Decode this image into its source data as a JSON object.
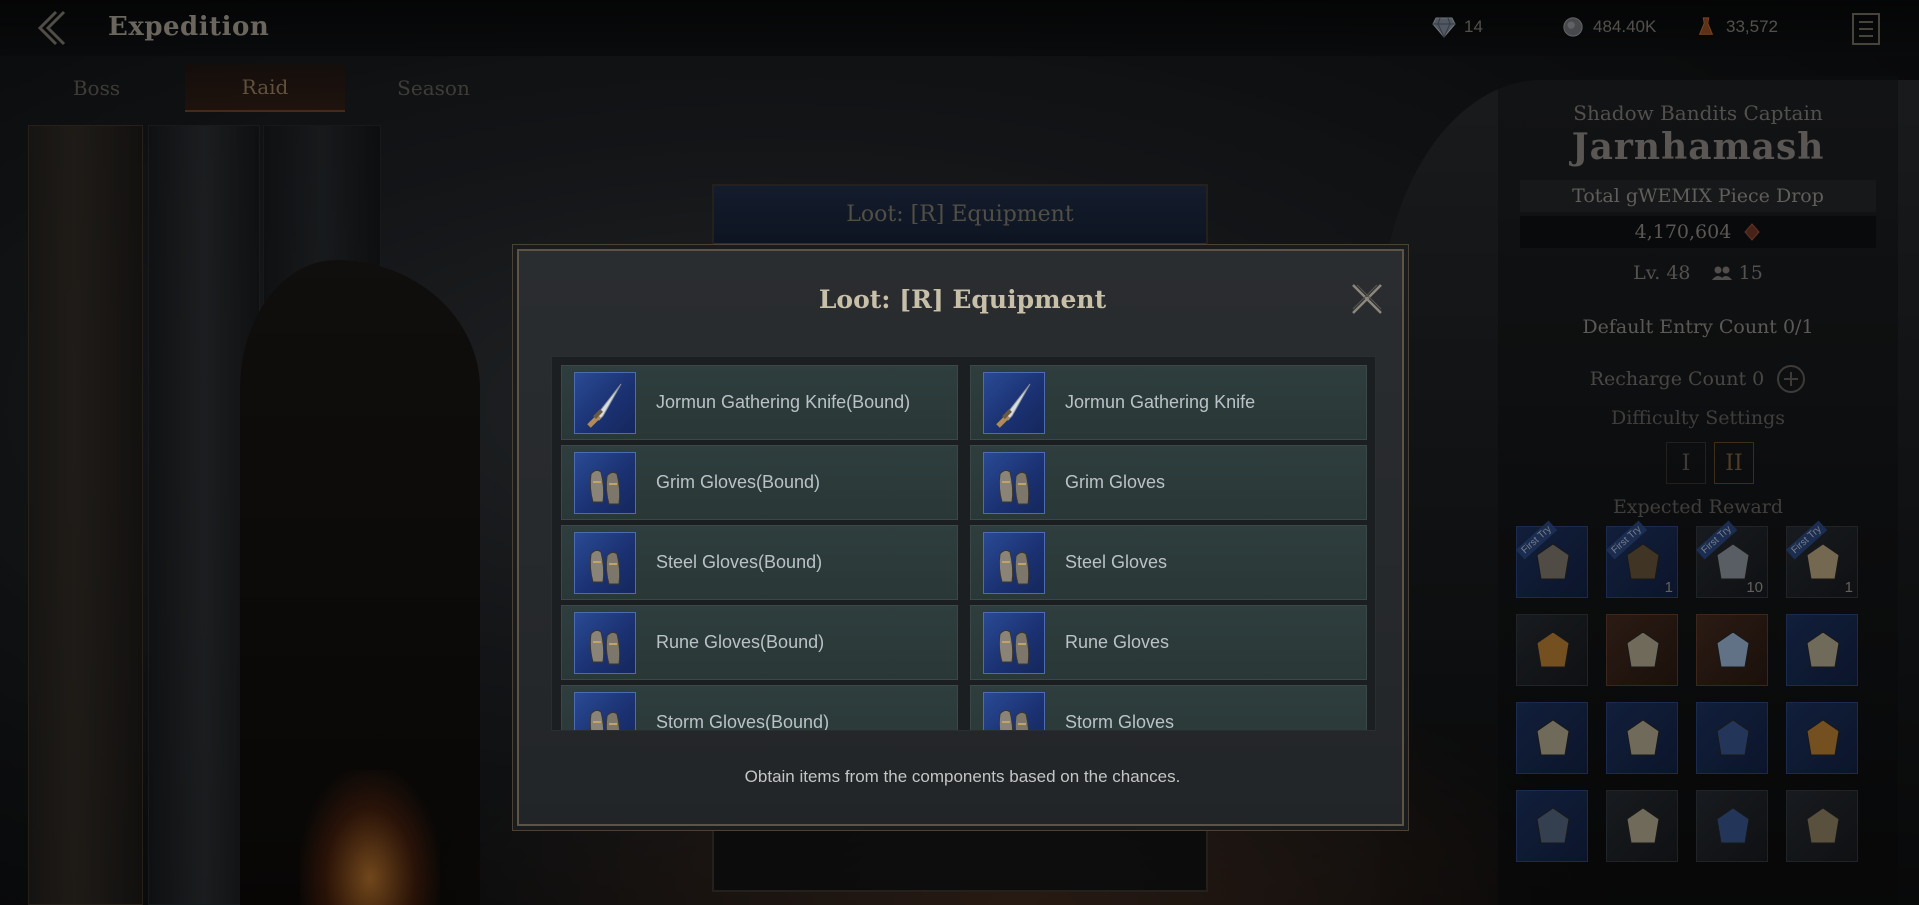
{
  "header": {
    "title": "Expedition",
    "currencies": [
      {
        "icon": "diamond-icon",
        "value": "14"
      },
      {
        "icon": "coin-icon",
        "value": "484.40K"
      },
      {
        "icon": "flask-icon",
        "value": "33,572"
      }
    ]
  },
  "tabs": [
    {
      "label": "Boss",
      "active": false
    },
    {
      "label": "Raid",
      "active": true
    },
    {
      "label": "Season",
      "active": false
    }
  ],
  "boss_panel": {
    "subtitle": "Shadow Bandits Captain",
    "name": "Jarnhamash",
    "drop_label": "Total gWEMIX Piece Drop",
    "drop_value": "4,170,604",
    "level": "Lv. 48",
    "party": "15",
    "entry_count": "Default Entry Count 0/1",
    "recharge_count": "Recharge Count 0",
    "difficulty_label": "Difficulty Settings",
    "difficulties": [
      "I",
      "II"
    ],
    "expected_label": "Expected Reward",
    "rewards": [
      {
        "icon": "gloves-icon",
        "badge": "First Try",
        "count": "",
        "style": "blue"
      },
      {
        "icon": "chest-icon",
        "badge": "First Try",
        "count": "1",
        "style": "blue"
      },
      {
        "icon": "crystal-icon",
        "badge": "First Try",
        "count": "10",
        "style": "dark"
      },
      {
        "icon": "map-icon",
        "badge": "First Try",
        "count": "1",
        "style": "dark"
      },
      {
        "icon": "amber-stone-icon",
        "badge": "",
        "count": "",
        "style": "dark"
      },
      {
        "icon": "scroll-icon",
        "badge": "",
        "count": "",
        "style": "brown"
      },
      {
        "icon": "blue-crystal-icon",
        "badge": "",
        "count": "",
        "style": "brown"
      },
      {
        "icon": "scroll-icon",
        "badge": "",
        "count": "",
        "style": "blue"
      },
      {
        "icon": "scroll-icon",
        "badge": "",
        "count": "",
        "style": "blue"
      },
      {
        "icon": "scroll-icon",
        "badge": "",
        "count": "",
        "style": "blue"
      },
      {
        "icon": "card-icon",
        "badge": "",
        "count": "",
        "style": "blue"
      },
      {
        "icon": "amber-stone-icon",
        "badge": "",
        "count": "",
        "style": "blue"
      },
      {
        "icon": "orb-icon",
        "badge": "",
        "count": "",
        "style": "blue"
      },
      {
        "icon": "scroll-icon",
        "badge": "",
        "count": "",
        "style": "dark"
      },
      {
        "icon": "card-icon",
        "badge": "",
        "count": "",
        "style": "dark"
      },
      {
        "icon": "medallion-icon",
        "badge": "",
        "count": "",
        "style": "dark"
      }
    ]
  },
  "back_dialog": {
    "title": "Loot: [R] Equipment"
  },
  "modal": {
    "title": "Loot: [R] Equipment",
    "footer": "Obtain items from the components based on the chances.",
    "items": [
      {
        "name": "Jormun Gathering Knife(Bound)",
        "icon": "knife-icon"
      },
      {
        "name": "Jormun Gathering Knife",
        "icon": "knife-icon"
      },
      {
        "name": "Grim Gloves(Bound)",
        "icon": "gloves-icon"
      },
      {
        "name": "Grim Gloves",
        "icon": "gloves-icon"
      },
      {
        "name": "Steel Gloves(Bound)",
        "icon": "gloves-icon"
      },
      {
        "name": "Steel Gloves",
        "icon": "gloves-icon"
      },
      {
        "name": "Rune Gloves(Bound)",
        "icon": "gloves-icon"
      },
      {
        "name": "Rune Gloves",
        "icon": "gloves-icon"
      },
      {
        "name": "Storm Gloves(Bound)",
        "icon": "gloves-icon"
      },
      {
        "name": "Storm Gloves",
        "icon": "gloves-icon"
      }
    ]
  },
  "colors": {
    "accent_gold": "#c8bfa9",
    "item_blue": "#1a3070",
    "tab_active": "#a78c68"
  }
}
